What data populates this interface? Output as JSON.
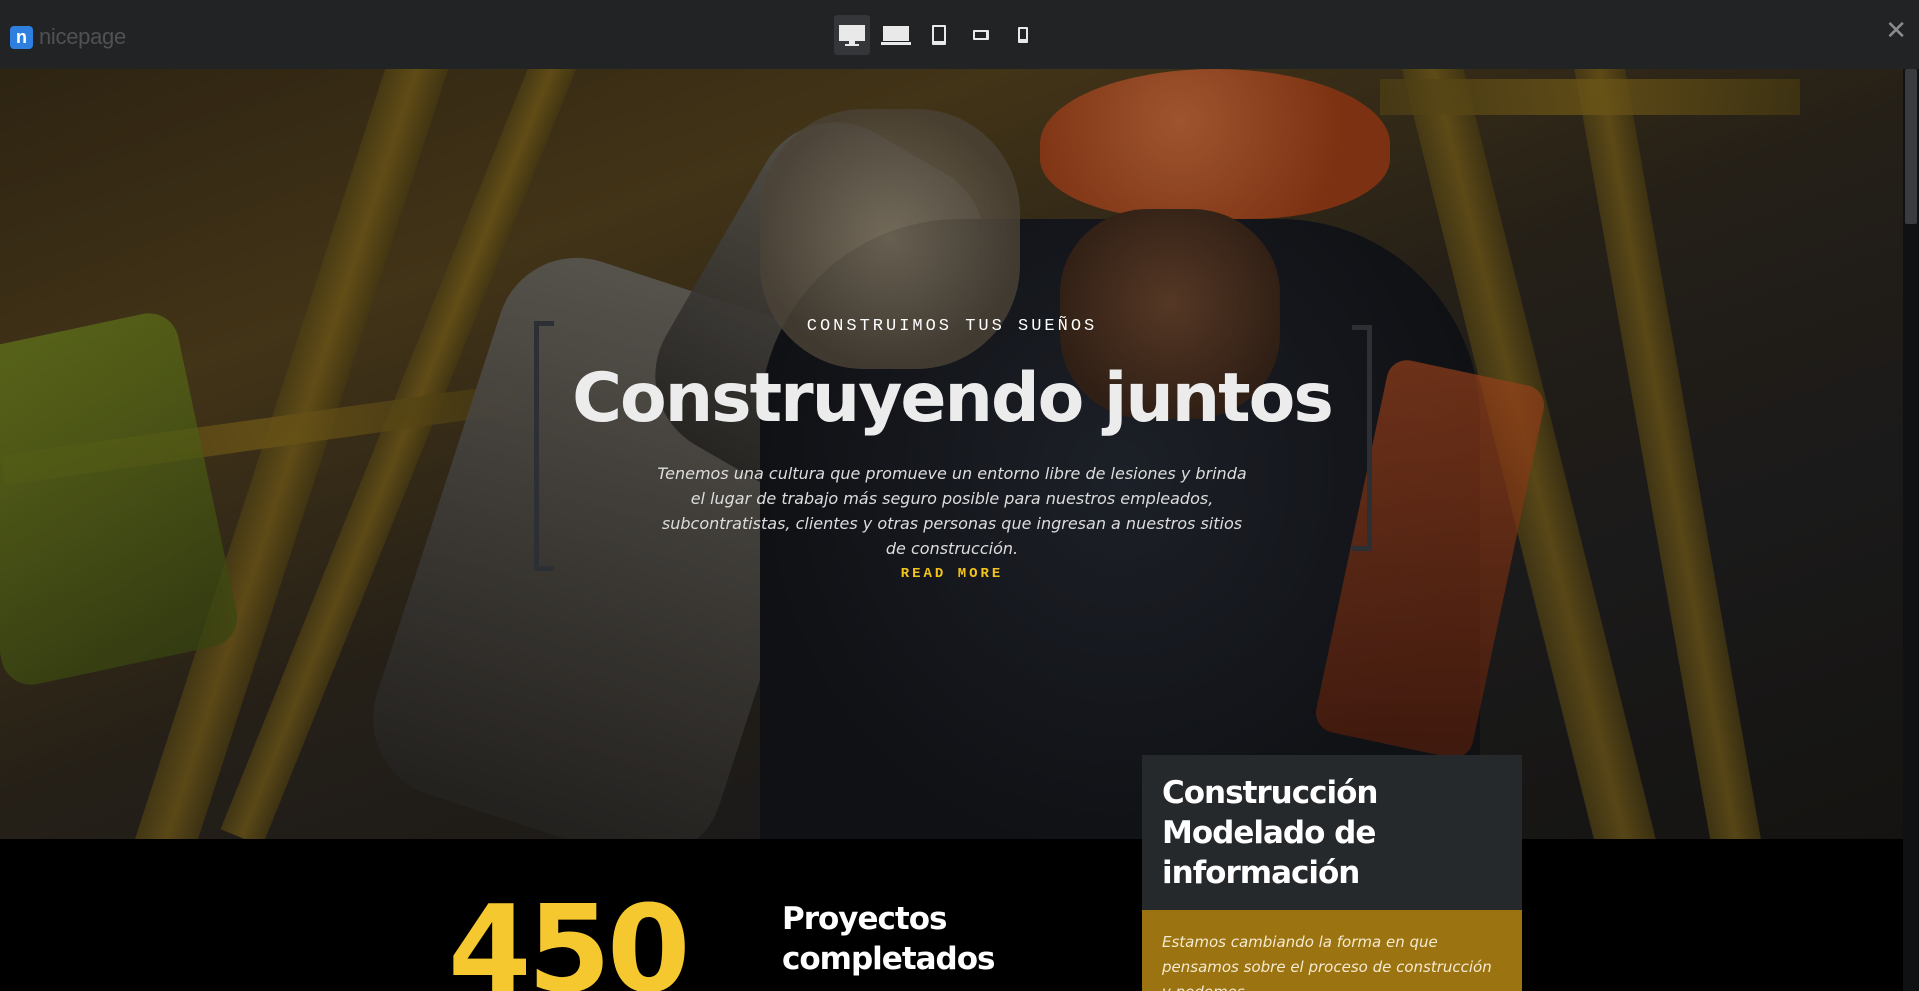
{
  "toolbar": {
    "logo_text": "nicepage",
    "device_buttons": [
      "desktop",
      "laptop",
      "tablet",
      "phone-landscape",
      "phone-portrait"
    ],
    "active_device": "desktop"
  },
  "hero": {
    "eyebrow": "CONSTRUIMOS TUS SUEÑOS",
    "title": "Construyendo juntos",
    "body": "Tenemos una cultura que promueve un entorno libre de lesiones y brinda el lugar de trabajo más seguro posible para nuestros empleados, subcontratistas, clientes y otras personas que ingresan a nuestros sitios de construcción.",
    "cta": "READ MORE"
  },
  "stats": {
    "number": "450",
    "label": "Proyectos completados"
  },
  "card": {
    "title": "Construcción Modelado de información",
    "text": "Estamos cambiando la forma en que pensamos sobre el proceso de construcción y podemos"
  },
  "colors": {
    "accent": "#f2c41c",
    "card_dark": "#26292c",
    "card_gold": "#9b7310",
    "logo_blue": "#2f7fe0"
  }
}
